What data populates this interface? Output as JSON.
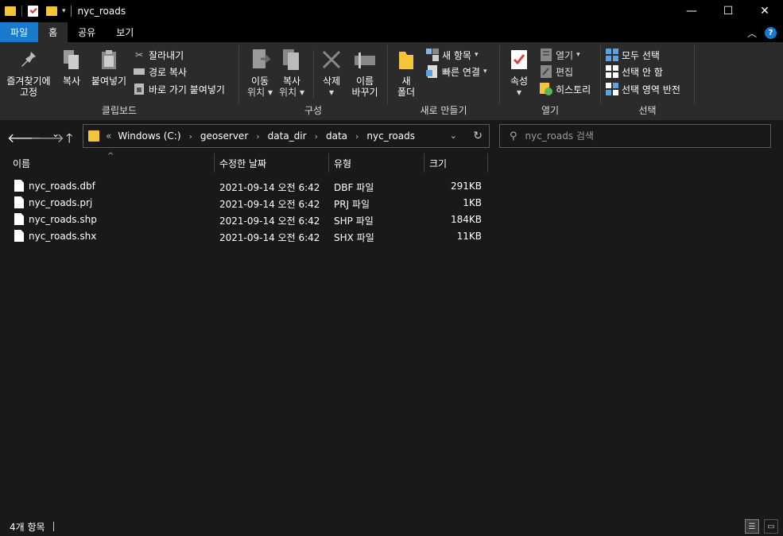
{
  "window": {
    "title": "nyc_roads",
    "minimize": "—",
    "maximize": "☐",
    "close": "✕"
  },
  "tabs": [
    {
      "label": "파일"
    },
    {
      "label": "홈"
    },
    {
      "label": "공유"
    },
    {
      "label": "보기"
    }
  ],
  "ribbon": {
    "clipboard": {
      "label": "클립보드",
      "pin": "즐겨찾기에 고정",
      "pin_line1": "즐겨찾기에",
      "pin_line2": "고정",
      "copy": "복사",
      "paste": "붙여넣기",
      "cut": "잘라내기",
      "copy_path": "경로 복사",
      "paste_shortcut": "바로 가기 붙여넣기"
    },
    "organize": {
      "label": "구성",
      "move_line1": "이동",
      "move_line2": "위치",
      "copy_line1": "복사",
      "copy_line2": "위치",
      "delete": "삭제",
      "rename_line1": "이름",
      "rename_line2": "바꾸기"
    },
    "new": {
      "label": "새로 만들기",
      "folder_line1": "새",
      "folder_line2": "폴더",
      "new_item": "새 항목",
      "easy_access": "빠른 연결"
    },
    "open": {
      "label": "열기",
      "properties": "속성",
      "open": "열기",
      "edit": "편집",
      "history": "히스토리"
    },
    "select": {
      "label": "선택",
      "select_all": "모두 선택",
      "select_none": "선택 안 함",
      "invert": "선택 영역 반전"
    }
  },
  "nav": {
    "back": "🡐",
    "forward": "🡒",
    "recent": "⌄",
    "up": "🡑",
    "breadcrumbs": [
      "Windows (C:)",
      "geoserver",
      "data_dir",
      "data",
      "nyc_roads"
    ],
    "overflow": "«",
    "search_placeholder": "nyc_roads 검색"
  },
  "columns": {
    "name": "이름",
    "modified": "수정한 날짜",
    "type": "유형",
    "size": "크기"
  },
  "files": [
    {
      "name": "nyc_roads.dbf",
      "modified": "2021-09-14 오전 6:42",
      "type": "DBF 파일",
      "size": "291KB"
    },
    {
      "name": "nyc_roads.prj",
      "modified": "2021-09-14 오전 6:42",
      "type": "PRJ 파일",
      "size": "1KB"
    },
    {
      "name": "nyc_roads.shp",
      "modified": "2021-09-14 오전 6:42",
      "type": "SHP 파일",
      "size": "184KB"
    },
    {
      "name": "nyc_roads.shx",
      "modified": "2021-09-14 오전 6:42",
      "type": "SHX 파일",
      "size": "11KB"
    }
  ],
  "status": {
    "count": "4개 항목"
  },
  "colors": {
    "accent": "#1979ca",
    "folder": "#f4c53b",
    "background": "#191919",
    "ribbon": "#2b2b2b"
  }
}
